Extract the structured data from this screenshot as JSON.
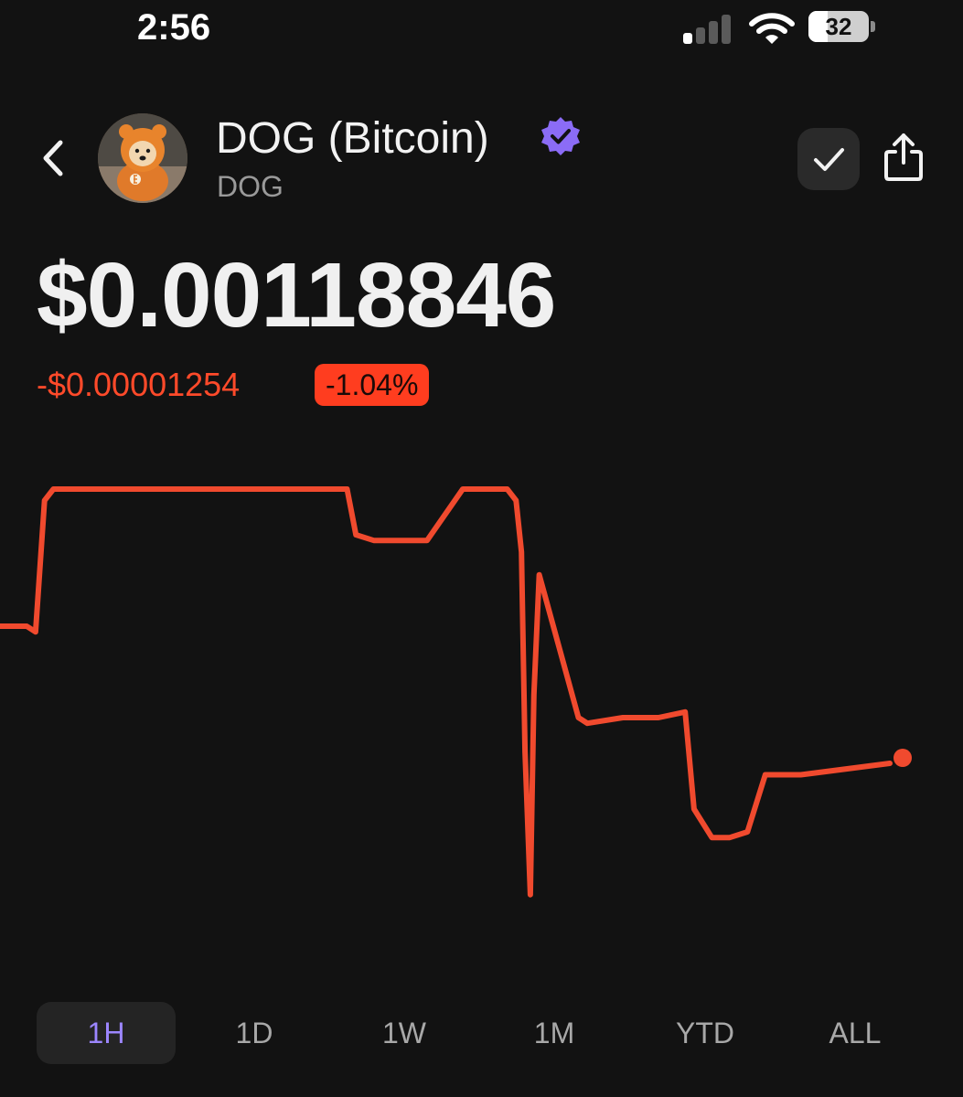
{
  "status_bar": {
    "time": "2:56",
    "battery": "32",
    "battery_fraction": 0.32
  },
  "header": {
    "title": "DOG (Bitcoin)",
    "ticker": "DOG",
    "accent_verified": "#8b6cf6"
  },
  "price": {
    "value": "$0.00118846",
    "change": "-$0.00001254",
    "change_percent": "-1.04%"
  },
  "colors": {
    "line": "#f04a2e",
    "negative": "#ff4a2a",
    "background": "#121212",
    "active_tab": "#9c86ff"
  },
  "chart_data": {
    "type": "line",
    "x": [
      0,
      3,
      4,
      5,
      6,
      12,
      20,
      26,
      30,
      34,
      39,
      40,
      42,
      44,
      48,
      52,
      56,
      57,
      58,
      58.6,
      59,
      59.6,
      60,
      60.6,
      62,
      65,
      66,
      70,
      72,
      74,
      77,
      78,
      80,
      82,
      84,
      86,
      90,
      100
    ],
    "values": [
      0.001212,
      0.001212,
      0.001211,
      0.001234,
      0.001236,
      0.001236,
      0.001236,
      0.001236,
      0.001236,
      0.001236,
      0.001236,
      0.001228,
      0.001227,
      0.001227,
      0.001227,
      0.001236,
      0.001236,
      0.001236,
      0.001234,
      0.001225,
      0.00119,
      0.001165,
      0.0012,
      0.001221,
      0.001213,
      0.001196,
      0.001195,
      0.001196,
      0.001196,
      0.001196,
      0.001197,
      0.00118,
      0.001175,
      0.001175,
      0.001176,
      0.001186,
      0.001186,
      0.001188
    ],
    "ylim": [
      0.00116,
      0.00124
    ],
    "grid": false,
    "end_marker": true,
    "xlabel": "",
    "ylabel": ""
  },
  "timeframes": [
    {
      "label": "1H",
      "active": true
    },
    {
      "label": "1D",
      "active": false
    },
    {
      "label": "1W",
      "active": false
    },
    {
      "label": "1M",
      "active": false
    },
    {
      "label": "YTD",
      "active": false
    },
    {
      "label": "ALL",
      "active": false
    }
  ]
}
